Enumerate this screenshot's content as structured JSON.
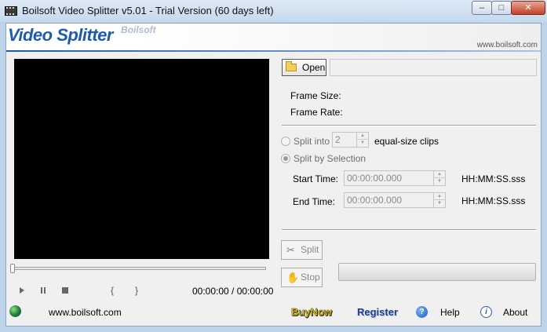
{
  "window": {
    "title": "Boilsoft Video Splitter v5.01 - Trial Version (60 days left)",
    "minimize_glyph": "–",
    "maximize_glyph": "□",
    "close_glyph": "✕"
  },
  "banner": {
    "logo_text": "Video Splitter",
    "logo_brand": "Boilsoft",
    "url": "www.boilsoft.com"
  },
  "player": {
    "prev_glyph": "{",
    "next_glyph": "}",
    "time": "00:00:00 / 00:00:00",
    "seek_position": 0
  },
  "file": {
    "open_label": "Open",
    "path_value": "",
    "frame_size_label": "Frame Size:",
    "frame_rate_label": "Frame Rate:"
  },
  "split_options": {
    "split_into_label": "Split into",
    "split_into_value": "2",
    "split_into_suffix": "equal-size clips",
    "split_by_selection_label": "Split by Selection",
    "selected_mode": "split_by_selection",
    "start_time_label": "Start Time:",
    "start_time_value": "00:00:00.000",
    "end_time_label": "End Time:",
    "end_time_value": "00:00:00.000",
    "time_format": "HH:MM:SS.sss"
  },
  "actions": {
    "split_label": "Split",
    "stop_label": "Stop",
    "progress": 0
  },
  "footer": {
    "website": "www.boilsoft.com",
    "buy_now": "BuyNow",
    "register": "Register",
    "help_label": "Help",
    "about_label": "About",
    "help_icon_glyph": "?",
    "about_icon_glyph": "i"
  }
}
